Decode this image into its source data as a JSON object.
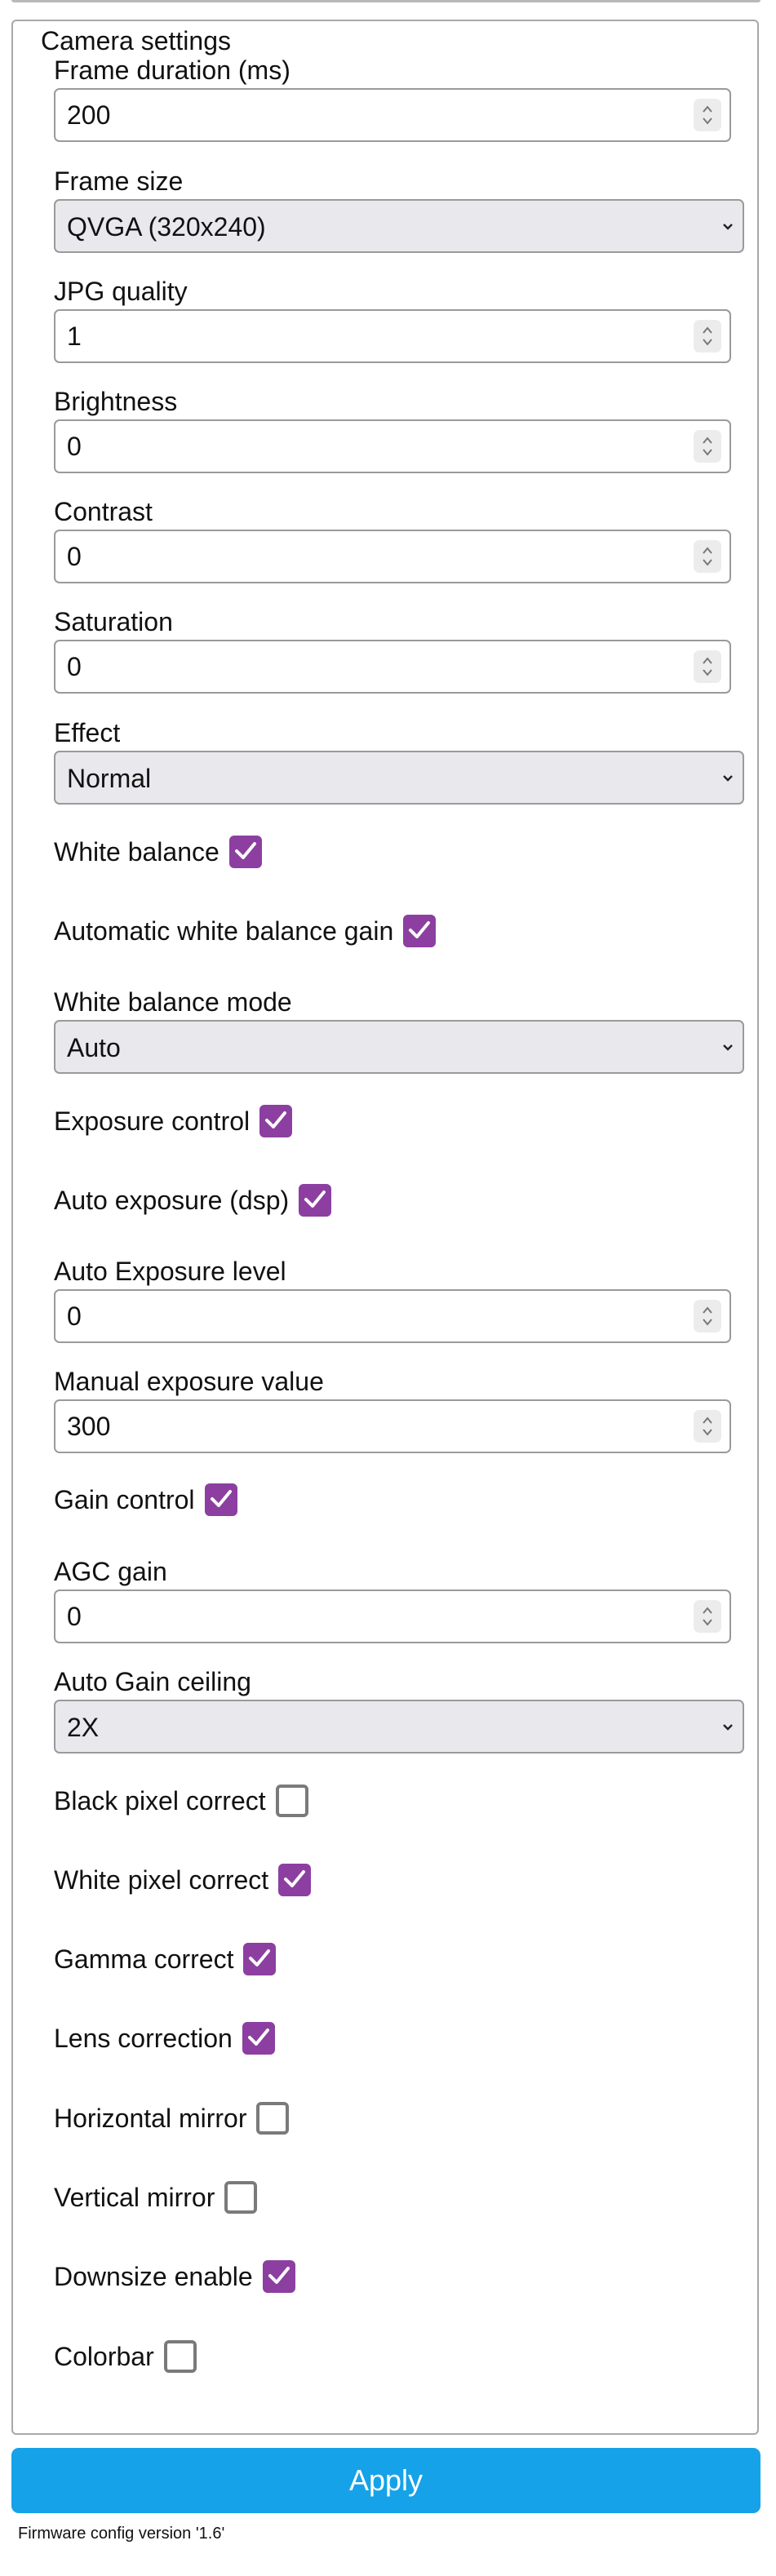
{
  "fieldset": {
    "legend": "Camera settings"
  },
  "fields": {
    "frame_duration": {
      "label": "Frame duration (ms)",
      "value": "200"
    },
    "frame_size": {
      "label": "Frame size",
      "value": "QVGA (320x240)"
    },
    "jpg_quality": {
      "label": "JPG quality",
      "value": "1"
    },
    "brightness": {
      "label": "Brightness",
      "value": "0"
    },
    "contrast": {
      "label": "Contrast",
      "value": "0"
    },
    "saturation": {
      "label": "Saturation",
      "value": "0"
    },
    "effect": {
      "label": "Effect",
      "value": "Normal"
    },
    "white_balance": {
      "label": "White balance",
      "checked": true
    },
    "awb_gain": {
      "label": "Automatic white balance gain",
      "checked": true
    },
    "wb_mode": {
      "label": "White balance mode",
      "value": "Auto"
    },
    "exposure_control": {
      "label": "Exposure control",
      "checked": true
    },
    "auto_exposure_dsp": {
      "label": "Auto exposure (dsp)",
      "checked": true
    },
    "ae_level": {
      "label": "Auto Exposure level",
      "value": "0"
    },
    "manual_exposure": {
      "label": "Manual exposure value",
      "value": "300"
    },
    "gain_control": {
      "label": "Gain control",
      "checked": true
    },
    "agc_gain": {
      "label": "AGC gain",
      "value": "0"
    },
    "gain_ceiling": {
      "label": "Auto Gain ceiling",
      "value": "2X"
    },
    "black_pixel_correct": {
      "label": "Black pixel correct",
      "checked": false
    },
    "white_pixel_correct": {
      "label": "White pixel correct",
      "checked": true
    },
    "gamma_correct": {
      "label": "Gamma correct",
      "checked": true
    },
    "lens_correction": {
      "label": "Lens correction",
      "checked": true
    },
    "horizontal_mirror": {
      "label": "Horizontal mirror",
      "checked": false
    },
    "vertical_mirror": {
      "label": "Vertical mirror",
      "checked": false
    },
    "downsize_enable": {
      "label": "Downsize enable",
      "checked": true
    },
    "colorbar": {
      "label": "Colorbar",
      "checked": false
    }
  },
  "apply_button": {
    "label": "Apply"
  },
  "footer": {
    "version_text": "Firmware config version '1.6'"
  },
  "colors": {
    "accent_checkbox": "#8c3fa0",
    "apply_button": "#16a2e8",
    "select_background": "#e9e9ed",
    "border": "#9a9a9a"
  },
  "icons": {
    "spinner": "up-down-arrows-icon",
    "dropdown": "chevron-down-icon",
    "check": "checkmark-icon"
  }
}
